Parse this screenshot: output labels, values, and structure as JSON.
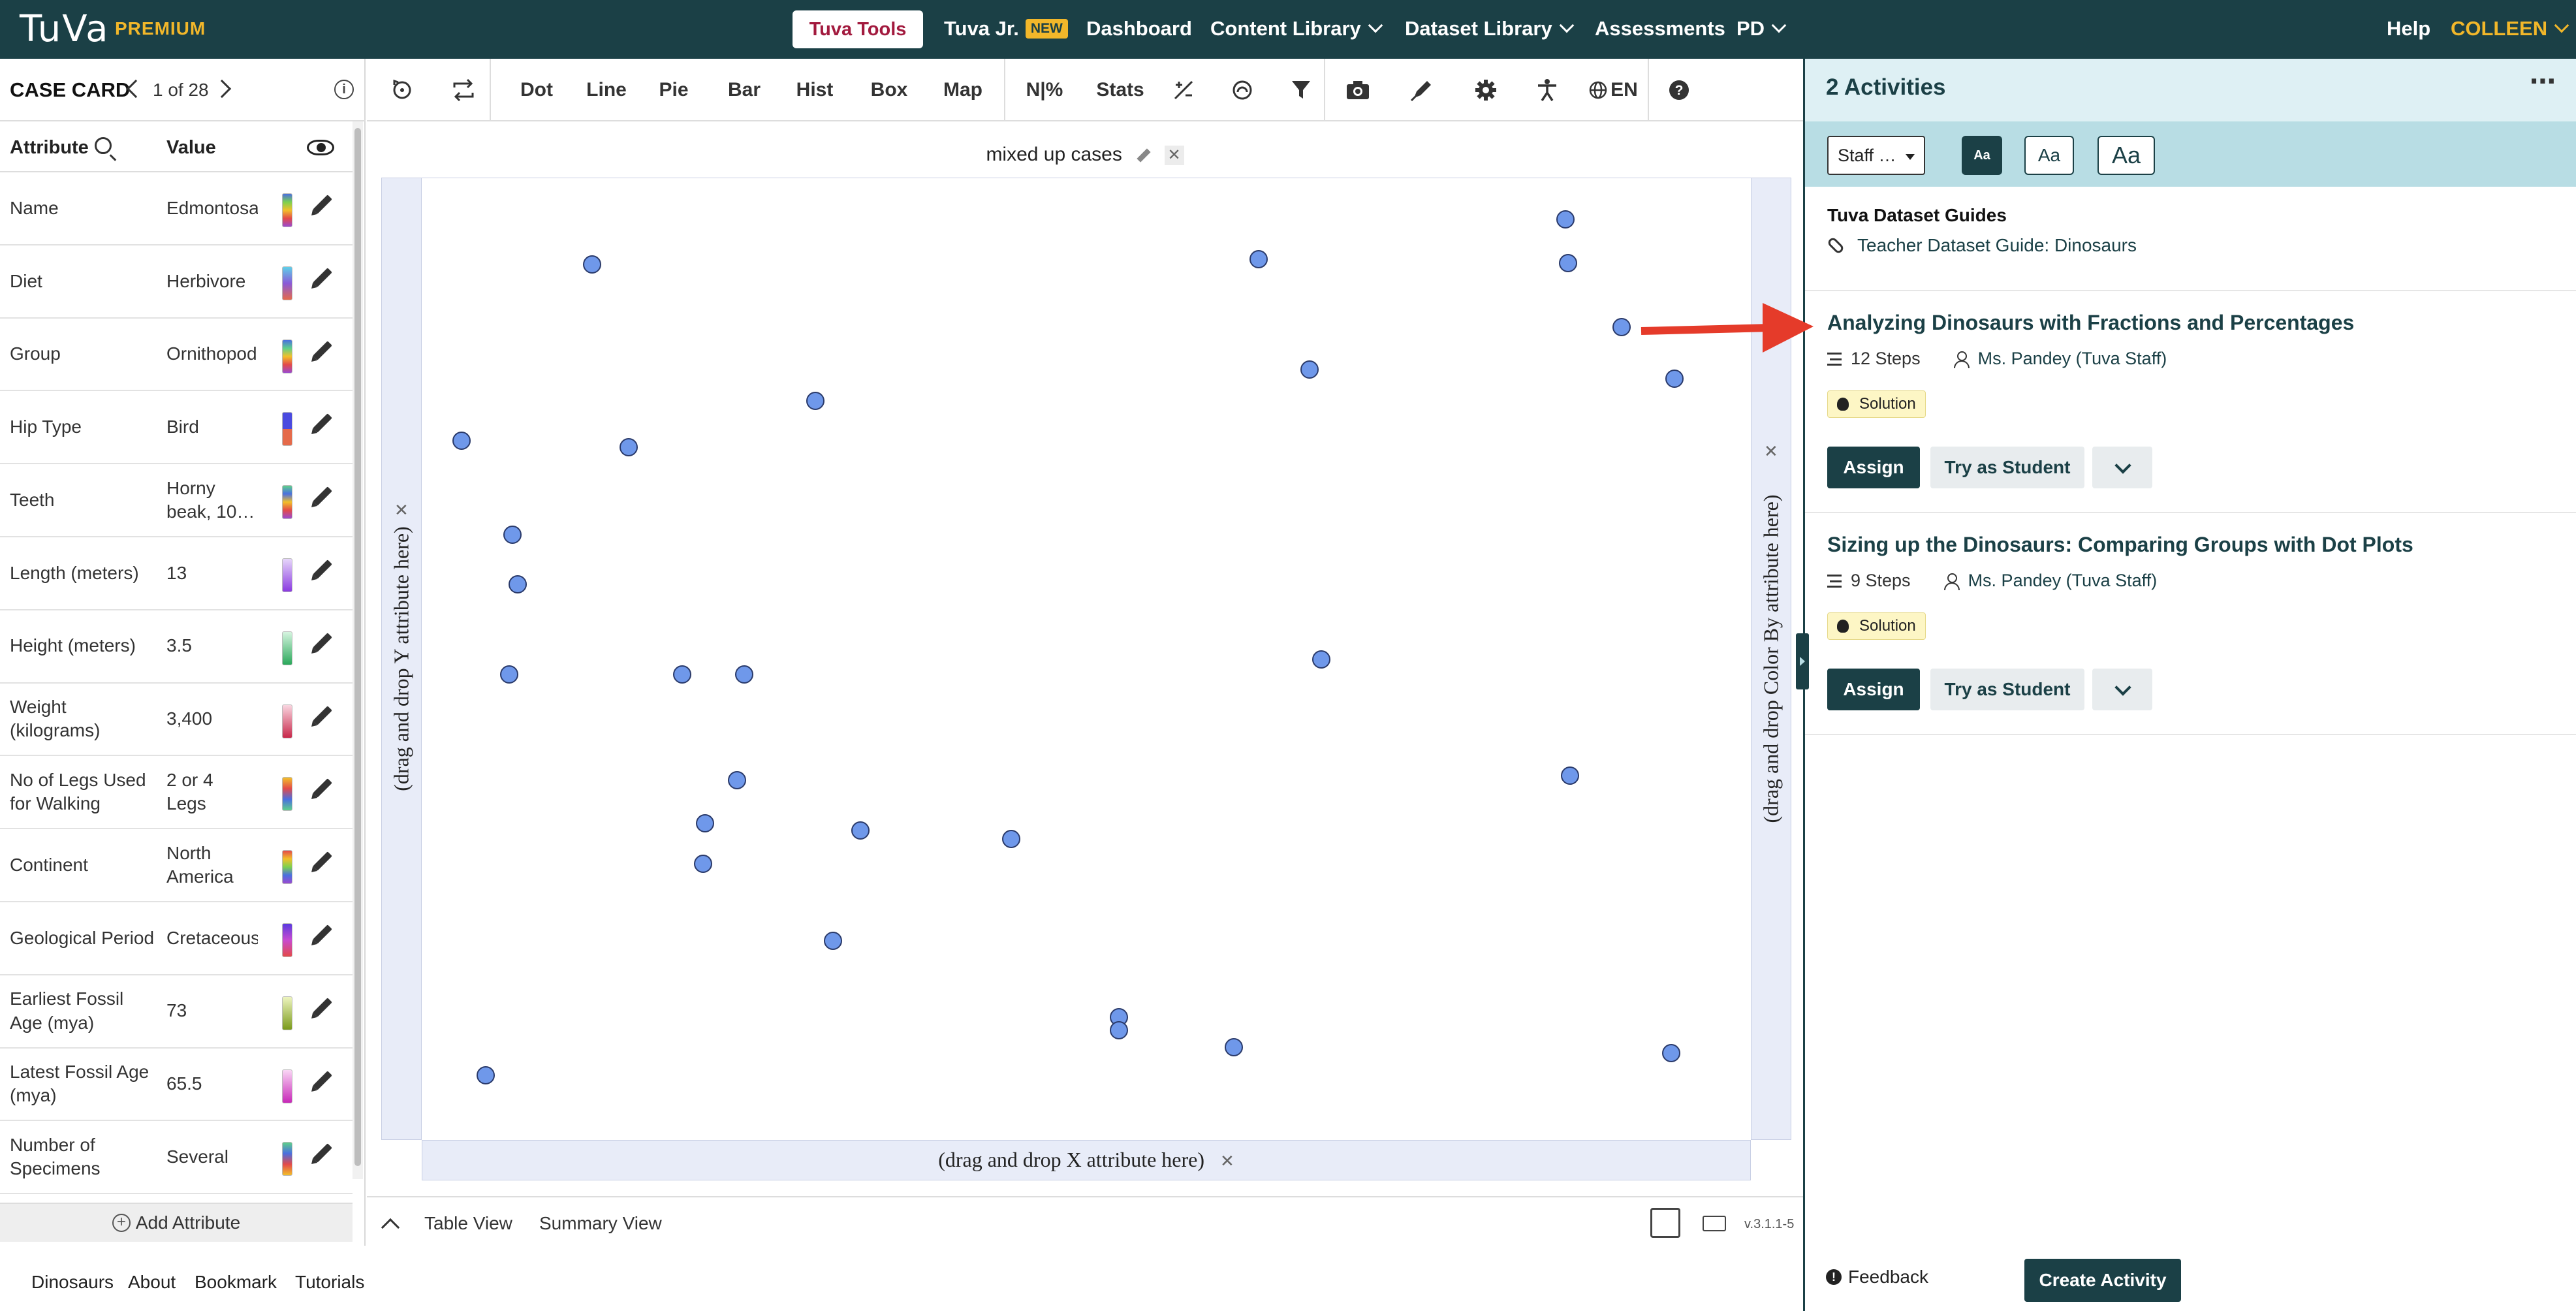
{
  "topnav": {
    "logo": "TuVa",
    "premium": "PREMIUM",
    "tuva_tools": "Tuva Tools",
    "tuva_jr": "Tuva Jr.",
    "new_badge": "NEW",
    "dashboard": "Dashboard",
    "content_library": "Content Library",
    "dataset_library": "Dataset Library",
    "assessments": "Assessments",
    "pd": "PD",
    "help": "Help",
    "user": "COLLEEN"
  },
  "casecard": {
    "title": "CASE CARD",
    "count": "1 of 28",
    "attr_header": "Attribute",
    "value_header": "Value",
    "add_attribute": "Add Attribute",
    "rows": [
      {
        "attr": "Name",
        "value": "Edmontosaurus",
        "swatch": "linear-gradient(#4a6fe0,#7bd14f,#f2c02a,#e34a4a,#9a4ad0)"
      },
      {
        "attr": "Diet",
        "value": "Herbivore",
        "swatch": "linear-gradient(#5ed0e8,#8a5ad8,#e56a4a)"
      },
      {
        "attr": "Group",
        "value": "Ornithopod",
        "swatch": "linear-gradient(#4a6fe0,#5ed08a,#f2c02a,#e34a4a,#9a4ad0)"
      },
      {
        "attr": "Hip Type",
        "value": "Bird",
        "swatch": "linear-gradient(#4a4ae0 50%,#e56a4a 50%)"
      },
      {
        "attr": "Teeth",
        "value": "Horny beak, 10…",
        "swatch": "linear-gradient(#5ed08a,#4a6fe0,#f2c02a,#e34a4a,#9a4ad0)"
      },
      {
        "attr": "Length (meters)",
        "value": "13",
        "swatch": "linear-gradient(#e6d6fa,#8a3ae0)"
      },
      {
        "attr": "Height (meters)",
        "value": "3.5",
        "swatch": "linear-gradient(#d6f5e0,#2aa85a)"
      },
      {
        "attr": "Weight (kilograms)",
        "value": "3,400",
        "swatch": "linear-gradient(#fad6e0,#c8284a)"
      },
      {
        "attr": "No of Legs Used for Walking",
        "value": "2 or 4 Legs",
        "swatch": "linear-gradient(#f2c02a,#e34a4a,#4a6fe0,#5ed08a)"
      },
      {
        "attr": "Continent",
        "value": "North America",
        "swatch": "linear-gradient(#e34a4a,#f2c02a,#7bd14f,#4a6fe0,#9a4ad0)"
      },
      {
        "attr": "Geological Period",
        "value": "Cretaceous",
        "swatch": "linear-gradient(#5a3ae0,#c84ad0,#e34a4a)"
      },
      {
        "attr": "Earliest Fossil Age (mya)",
        "value": "73",
        "swatch": "linear-gradient(#eef5c0,#7a9a1a)"
      },
      {
        "attr": "Latest Fossil Age (mya)",
        "value": "65.5",
        "swatch": "linear-gradient(#fad6f5,#c828b8)"
      },
      {
        "attr": "Number of Specimens",
        "value": "Several",
        "swatch": "linear-gradient(#5ed08a,#4a6fe0,#e34a4a,#f2c02a)"
      }
    ]
  },
  "toolbar": {
    "dot": "Dot",
    "line": "Line",
    "pie": "Pie",
    "bar": "Bar",
    "hist": "Hist",
    "box": "Box",
    "map": "Map",
    "npct": "N|%",
    "stats": "Stats",
    "lang": "EN"
  },
  "graph": {
    "title": "mixed up cases",
    "y_placeholder": "(drag and drop Y attribute here)",
    "x_placeholder": "(drag and drop X attribute here)",
    "color_placeholder": "(drag and drop Color By attribute here)",
    "point_color": "#6f98ea"
  },
  "bottombar": {
    "table_view": "Table View",
    "summary_view": "Summary View",
    "version": "v.3.1.1-5"
  },
  "footer": {
    "dinosaurs": "Dinosaurs",
    "about": "About",
    "bookmark": "Bookmark",
    "tutorials": "Tutorials"
  },
  "rpanel": {
    "title": "2 Activities",
    "staff_select": "Staff …",
    "font_small": "Aa",
    "font_med": "Aa",
    "font_large": "Aa",
    "guides_title": "Tuva Dataset Guides",
    "guide_link": "Teacher Dataset Guide: Dinosaurs",
    "activities": [
      {
        "title": "Analyzing Dinosaurs with Fractions and Percentages",
        "steps": "12 Steps",
        "author": "Ms. Pandey (Tuva Staff)",
        "badge": "Solution",
        "assign": "Assign",
        "try": "Try as Student"
      },
      {
        "title": "Sizing up the Dinosaurs: Comparing Groups with Dot Plots",
        "steps": "9 Steps",
        "author": "Ms. Pandey (Tuva Staff)",
        "badge": "Solution",
        "assign": "Assign",
        "try": "Try as Student"
      }
    ],
    "feedback": "Feedback",
    "create_activity": "Create Activity"
  }
}
